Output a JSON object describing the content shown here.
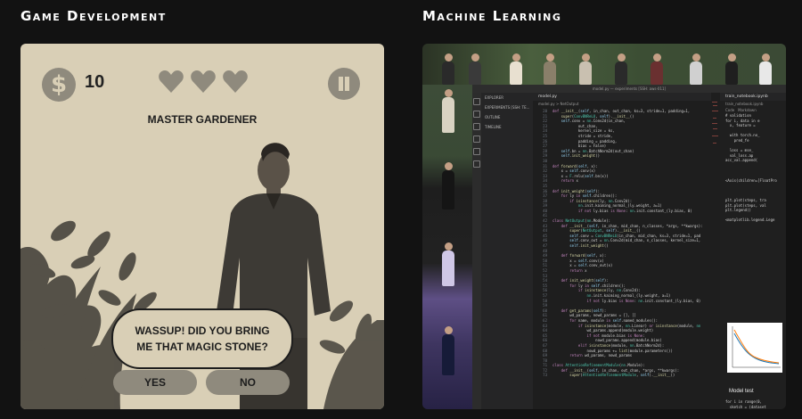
{
  "headings": {
    "game": "Game Development",
    "ml": "Machine Learning"
  },
  "game": {
    "coins": "10",
    "hearts": 3,
    "level_title": "MASTER GARDENER",
    "speech": [
      "WASSUP! DID YOU BRING",
      "ME THAT MAGIC STONE?"
    ],
    "yes_label": "YES",
    "no_label": "NO",
    "colors": {
      "card": "#d9cfb6",
      "icon": "#8f8a7d",
      "ink": "#1d1d1d"
    }
  },
  "ml": {
    "window_title": "model.py — experiments [SSH: aws-011]",
    "explorer": {
      "header": "EXPLORER",
      "items": [
        "EXPERIMENTS [SSH: TE...",
        "OUTLINE",
        "TIMELINE"
      ]
    },
    "editor_tab": "model.py",
    "breadcrumb": "model.py > NetOutput",
    "notebook_tabs": [
      "train_notebook.ipynb",
      "train_notebook.ipynb"
    ],
    "notebook_toolbar": [
      "Code",
      "Markdown"
    ],
    "model_test": "Model test",
    "code_lines": [
      [
        "20",
        "def __init__(self, in_chan, out_chan, ks=3, stride=1, padding=1,"
      ],
      [
        "21",
        "    super(ConvBNReLU, self).__init__()"
      ],
      [
        "22",
        "    self.conv = nn.Conv2d(in_chan,"
      ],
      [
        "23",
        "            out_chan,"
      ],
      [
        "24",
        "            kernel_size = ks,"
      ],
      [
        "25",
        "            stride = stride,"
      ],
      [
        "26",
        "            padding = padding,"
      ],
      [
        "27",
        "            bias = False)"
      ],
      [
        "28",
        "    self.bn = nn.BatchNorm2d(out_chan)"
      ],
      [
        "29",
        "    self.init_weight()"
      ],
      [
        "30",
        ""
      ],
      [
        "31",
        "def forward(self, x):"
      ],
      [
        "32",
        "    x = self.conv(x)"
      ],
      [
        "33",
        "    x = F.relu(self.bn(x))"
      ],
      [
        "34",
        "    return x"
      ],
      [
        "35",
        ""
      ],
      [
        "36",
        "def init_weight(self):"
      ],
      [
        "37",
        "    for ly in self.children():"
      ],
      [
        "38",
        "        if isinstance(ly, nn.Conv2d):"
      ],
      [
        "39",
        "            nn.init.kaiming_normal_(ly.weight, a=1)"
      ],
      [
        "40",
        "            if not ly.bias is None: nn.init.constant_(ly.bias, 0)"
      ],
      [
        "41",
        ""
      ],
      [
        "42",
        "class NetOutput(nn.Module):"
      ],
      [
        "43",
        "    def __init__(self, in_chan, mid_chan, n_classes, *args, **kwargs):"
      ],
      [
        "44",
        "        super(NetOutput, self).__init__()"
      ],
      [
        "45",
        "        self.conv = ConvBNReLU(in_chan, mid_chan, ks=3, stride=1, pad"
      ],
      [
        "46",
        "        self.conv_out = nn.Conv2d(mid_chan, n_classes, kernel_size=1,"
      ],
      [
        "47",
        "        self.init_weight()"
      ],
      [
        "48",
        ""
      ],
      [
        "49",
        "    def forward(self, x):"
      ],
      [
        "50",
        "        x = self.conv(x)"
      ],
      [
        "51",
        "        x = self.conv_out(x)"
      ],
      [
        "52",
        "        return x"
      ],
      [
        "53",
        ""
      ],
      [
        "54",
        "    def init_weight(self):"
      ],
      [
        "55",
        "        for ly in self.children():"
      ],
      [
        "56",
        "            if isinstance(ly, nn.Conv2d):"
      ],
      [
        "57",
        "                nn.init.kaiming_normal_(ly.weight, a=1)"
      ],
      [
        "58",
        "                if not ly.bias is None: nn.init.constant_(ly.bias, 0)"
      ],
      [
        "59",
        ""
      ],
      [
        "60",
        "    def get_params(self):"
      ],
      [
        "61",
        "        wd_params, nowd_params = [], []"
      ],
      [
        "62",
        "        for name, module in self.named_modules():"
      ],
      [
        "63",
        "            if isinstance(module, nn.Linear) or isinstance(module, nn"
      ],
      [
        "64",
        "                wd_params.append(module.weight)"
      ],
      [
        "65",
        "                if not module.bias is None:"
      ],
      [
        "66",
        "                    nowd_params.append(module.bias)"
      ],
      [
        "67",
        "            elif isinstance(module, nn.BatchNorm2d):"
      ],
      [
        "68",
        "                nowd_params += list(module.parameters())"
      ],
      [
        "69",
        "        return wd_params, nowd_params"
      ],
      [
        "70",
        ""
      ],
      [
        "71",
        "class AttentionRefinementModule(nn.Module):"
      ],
      [
        "72",
        "    def __init__(self, in_chan, out_chan, *args, **kwargs):"
      ],
      [
        "73",
        "        super(AttentionRefinementModule, self).__init__()"
      ]
    ],
    "notebook_code": [
      "# validation",
      "for i, data in e",
      "  x, feature =",
      "",
      "  with torch.no_",
      "    pred_fe",
      "",
      "  loss = mse_",
      "  val_loss.ap",
      "acc_val.append(",
      "",
      "",
      "",
      "<Axis(children=[FloatPro",
      "",
      "",
      "",
      "plt.plot(steps, tra",
      "plt.plot(steps, val",
      "plt.legend()",
      "",
      "<matplotlib.legend.Lege"
    ],
    "notebook_code_after": [
      "for i in range(0,",
      "  sketch = (dataset",
      "",
      "  with torch.no_gr",
      "    curr_images",
      "",
      "  target = tensor"
    ]
  }
}
